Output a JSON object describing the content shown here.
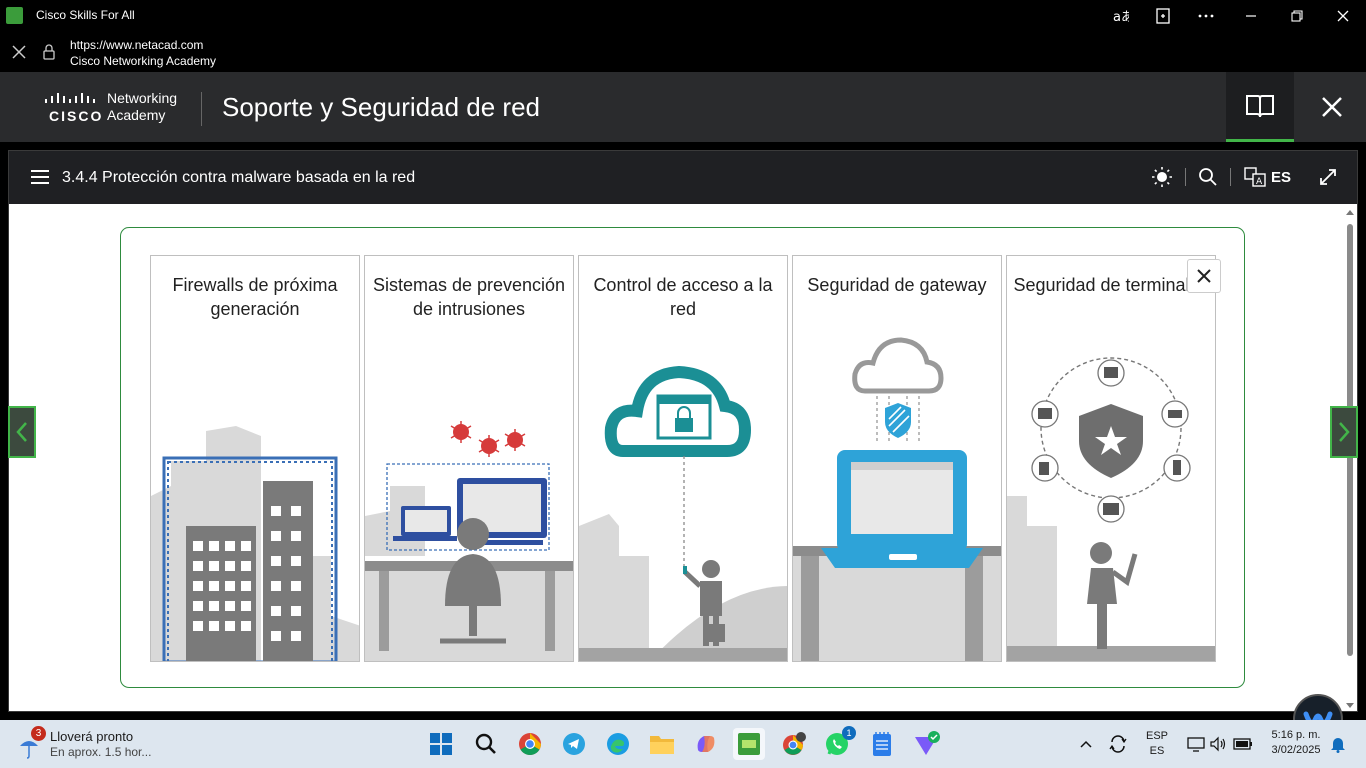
{
  "window": {
    "title": "Cisco Skills For All",
    "url": "https://www.netacad.com",
    "site_name": "Cisco Networking Academy"
  },
  "header": {
    "logo_word": "CISCO",
    "logo_line1": "Networking",
    "logo_line2": "Academy",
    "course_title": "Soporte y Seguridad de red"
  },
  "module": {
    "title": "3.4.4 Protección contra malware basada en la red",
    "language": "ES"
  },
  "cards": [
    {
      "title": "Firewalls de próxima generación"
    },
    {
      "title": "Sistemas de prevención de intrusiones"
    },
    {
      "title": "Control de acceso a la red"
    },
    {
      "title": "Seguridad de gateway"
    },
    {
      "title": "Seguridad de terminales"
    }
  ],
  "taskbar": {
    "weather_badge": "3",
    "weather_line1": "Lloverá pronto",
    "weather_line2": "En aprox. 1.5 hor...",
    "whatsapp_badge": "1",
    "lang_line1": "ESP",
    "lang_line2": "ES",
    "time": "5:16 p. m.",
    "date": "3/02/2025"
  },
  "colors": {
    "accent_green": "#42b549",
    "box_green": "#2e8b3e",
    "teal": "#1b8f95",
    "blue_laptop": "#2ea3d8",
    "red_bug": "#d63b3b"
  }
}
